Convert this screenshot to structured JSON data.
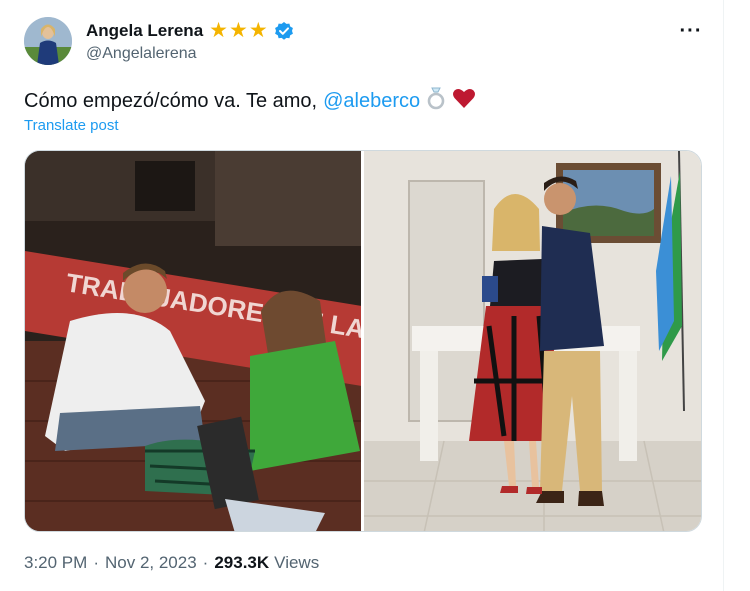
{
  "author": {
    "display_name": "Angela Lerena",
    "handle": "@Angelalerena",
    "badges": [
      "star-icon",
      "star-icon",
      "star-icon",
      "verified-badge-icon"
    ],
    "badge_colors": {
      "star": "#f4b400",
      "verified": "#1d9bf0"
    }
  },
  "menu": {
    "more_label": "···"
  },
  "tweet": {
    "text": "Cómo empezó/cómo va. Te amo,",
    "mention": "@aleberco",
    "emojis": [
      "ring-icon",
      "red-heart-icon"
    ],
    "translate_label": "Translate post"
  },
  "media": {
    "photos": [
      {
        "name": "photo-how-it-started",
        "banner_text": "TRABAJADORES DE LA POLÍTICA"
      },
      {
        "name": "photo-how-its-going"
      }
    ]
  },
  "meta": {
    "time": "3:20 PM",
    "separator": "·",
    "date": "Nov 2, 2023",
    "views_count": "293.3K",
    "views_label": "Views"
  },
  "colors": {
    "text": "#0f1419",
    "secondary_text": "#536471",
    "link": "#1d9bf0"
  }
}
